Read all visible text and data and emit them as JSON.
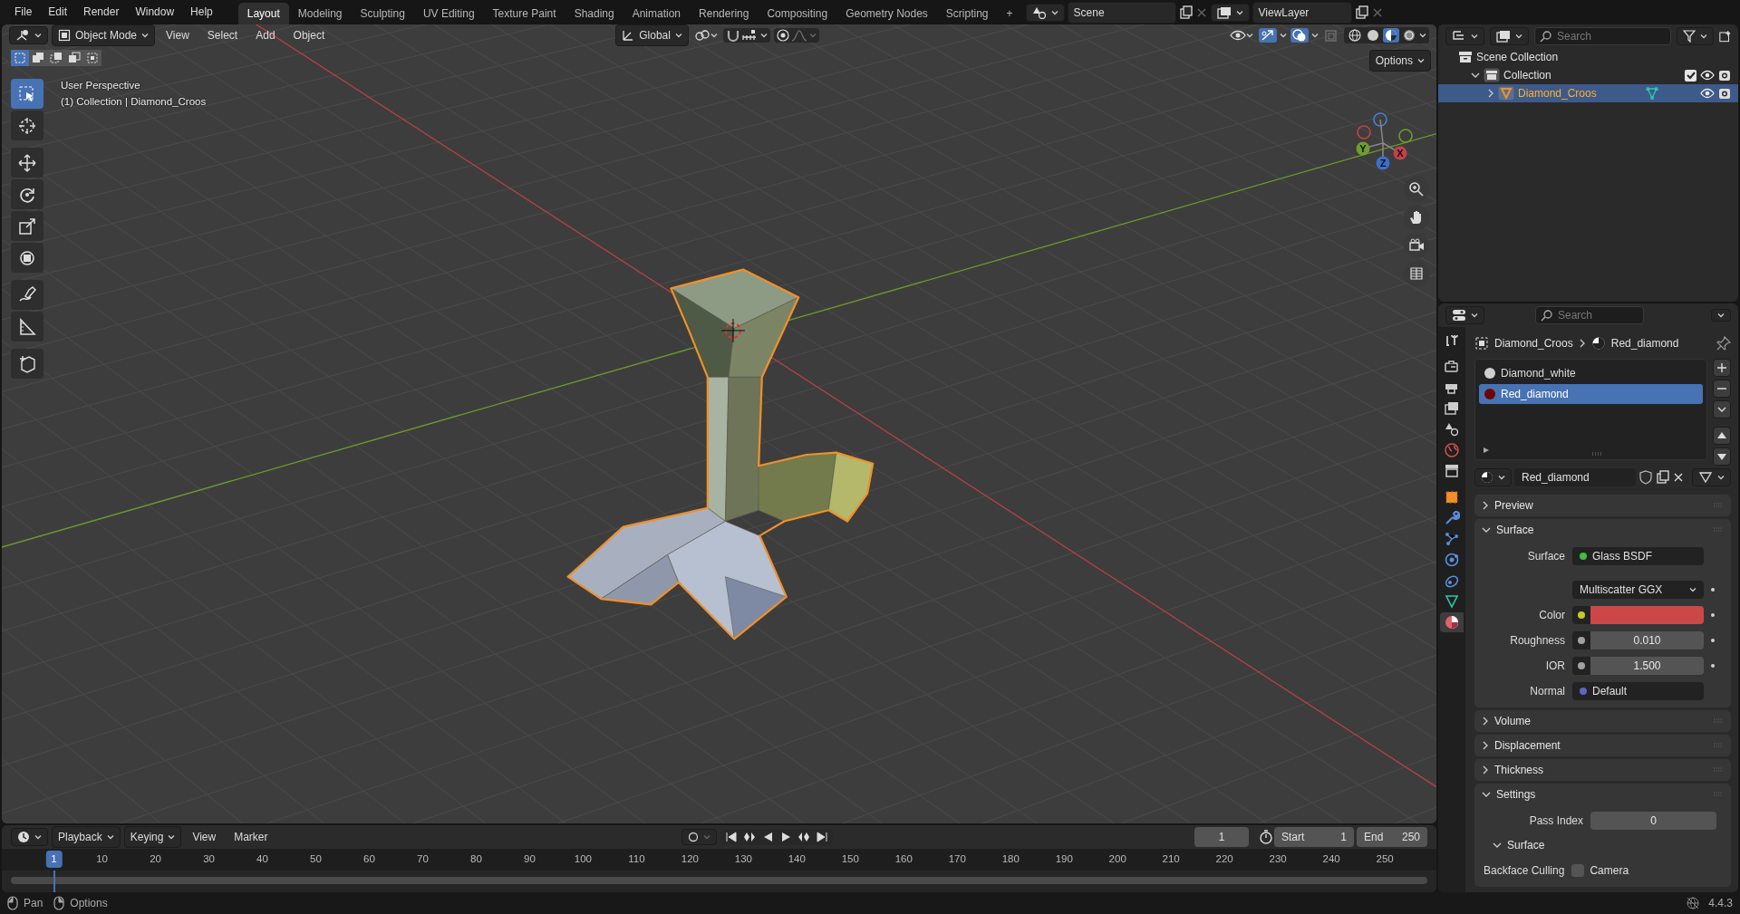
{
  "menu": [
    "File",
    "Edit",
    "Render",
    "Window",
    "Help"
  ],
  "workspaces": [
    {
      "label": "Layout",
      "selected": true
    },
    {
      "label": "Modeling",
      "selected": false
    },
    {
      "label": "Sculpting",
      "selected": false
    },
    {
      "label": "UV Editing",
      "selected": false
    },
    {
      "label": "Texture Paint",
      "selected": false
    },
    {
      "label": "Shading",
      "selected": false
    },
    {
      "label": "Animation",
      "selected": false
    },
    {
      "label": "Rendering",
      "selected": false
    },
    {
      "label": "Compositing",
      "selected": false
    },
    {
      "label": "Geometry Nodes",
      "selected": false
    },
    {
      "label": "Scripting",
      "selected": false
    }
  ],
  "add_workspace": "+",
  "scene": "Scene",
  "view_layer": "ViewLayer",
  "viewport": {
    "mode": "Object Mode",
    "menus": [
      "View",
      "Select",
      "Add",
      "Object"
    ],
    "orientation": "Global",
    "options": "Options",
    "perspective": "User Perspective",
    "context": "(1) Collection | Diamond_Croos",
    "select_modes": [
      {
        "selected": true
      },
      {
        "selected": false
      },
      {
        "selected": false
      },
      {
        "selected": false
      },
      {
        "selected": false
      }
    ],
    "tools": [
      {
        "kind": "select",
        "selected": true
      },
      {
        "kind": "cursor",
        "selected": false
      },
      {
        "kind": "move",
        "selected": false
      },
      {
        "kind": "rotate",
        "selected": false
      },
      {
        "kind": "scale",
        "selected": false
      },
      {
        "kind": "transform",
        "selected": false
      },
      {
        "kind": "annotate",
        "selected": false
      },
      {
        "kind": "measure",
        "selected": false
      },
      {
        "kind": "add_cube",
        "selected": false
      }
    ],
    "shading": [
      {
        "kind": "wireframe",
        "selected": false
      },
      {
        "kind": "solid",
        "selected": false
      },
      {
        "kind": "material",
        "selected": true
      },
      {
        "kind": "rendered",
        "selected": false
      }
    ],
    "gizmo": {
      "x": "X",
      "y": "Y",
      "z": "Z"
    }
  },
  "outliner": {
    "search_placeholder": "Search",
    "tree": [
      {
        "label": "Scene Collection",
        "kind": "scene",
        "children": [
          {
            "label": "Collection",
            "kind": "collection",
            "expanded": true,
            "checked": true,
            "selected": false,
            "children": [
              {
                "label": "Diamond_Croos",
                "kind": "object",
                "expanded": false,
                "selected": true
              }
            ]
          }
        ]
      }
    ]
  },
  "properties": {
    "search_placeholder": "Search",
    "tabs": [
      {
        "kind": "tool",
        "selected": false
      },
      {
        "kind": "render",
        "selected": false
      },
      {
        "kind": "output",
        "selected": false
      },
      {
        "kind": "view_layer",
        "selected": false
      },
      {
        "kind": "scene",
        "selected": false
      },
      {
        "kind": "world",
        "selected": false
      },
      {
        "kind": "collection",
        "selected": false
      },
      {
        "kind": "object",
        "selected": false
      },
      {
        "kind": "modifiers",
        "selected": false
      },
      {
        "kind": "particles",
        "selected": false
      },
      {
        "kind": "physics",
        "selected": false
      },
      {
        "kind": "constraints",
        "selected": false
      },
      {
        "kind": "data",
        "selected": false
      },
      {
        "kind": "material",
        "selected": true
      }
    ],
    "breadcrumb": [
      "Diamond_Croos",
      "Red_diamond"
    ],
    "material_slots": [
      {
        "name": "Diamond_white",
        "color": "#cfcfcf",
        "selected": false
      },
      {
        "name": "Red_diamond",
        "color": "#6a0808",
        "selected": true
      }
    ],
    "material_name": "Red_diamond",
    "panels": [
      {
        "title": "Preview",
        "expanded": false
      },
      {
        "title": "Surface",
        "expanded": true,
        "rows": [
          {
            "kind": "link",
            "label": "Surface",
            "value": "Glass BSDF",
            "socket": {
              "color": "#3fbf3f"
            }
          },
          {
            "kind": "dropdown",
            "value": "Multiscatter GGX"
          },
          {
            "kind": "color",
            "label": "Color",
            "color": "#cc4747",
            "socket": {
              "color": "#c7c72a"
            }
          },
          {
            "kind": "number",
            "label": "Roughness",
            "value": "0.010",
            "socket": {
              "color": "#a1a1a1"
            }
          },
          {
            "kind": "number",
            "label": "IOR",
            "value": "1.500",
            "socket": {
              "color": "#a1a1a1"
            }
          },
          {
            "kind": "link",
            "label": "Normal",
            "value": "Default",
            "socket": {
              "color": "#6363c7"
            }
          }
        ]
      },
      {
        "title": "Volume",
        "expanded": false
      },
      {
        "title": "Displacement",
        "expanded": false
      },
      {
        "title": "Thickness",
        "expanded": false
      },
      {
        "title": "Settings",
        "expanded": true,
        "rows": [
          {
            "kind": "number",
            "label": "Pass Index",
            "value": "0"
          },
          {
            "kind": "subpanel",
            "title": "Surface",
            "expanded": true
          },
          {
            "kind": "checkbox",
            "label": "Backface Culling",
            "text": "Camera",
            "checked": false
          }
        ]
      }
    ]
  },
  "timeline": {
    "menus": [
      "Playback",
      "Keying",
      "View",
      "Marker"
    ],
    "auto_key": {
      "on": false
    },
    "ticks": [
      "10",
      "20",
      "30",
      "40",
      "50",
      "60",
      "70",
      "80",
      "90",
      "100",
      "110",
      "120",
      "130",
      "140",
      "150",
      "160",
      "170",
      "180",
      "190",
      "200",
      "210",
      "220",
      "230",
      "240",
      "250"
    ],
    "current_frame": "1",
    "frame": "1",
    "start_label": "Start",
    "start": "1",
    "end_label": "End",
    "end": "250"
  },
  "status_bar": {
    "hints": [
      {
        "kind": "mouse_left",
        "label": "Pan"
      },
      {
        "kind": "mouse_right",
        "label": "Options"
      }
    ],
    "version": "4.4.3"
  }
}
